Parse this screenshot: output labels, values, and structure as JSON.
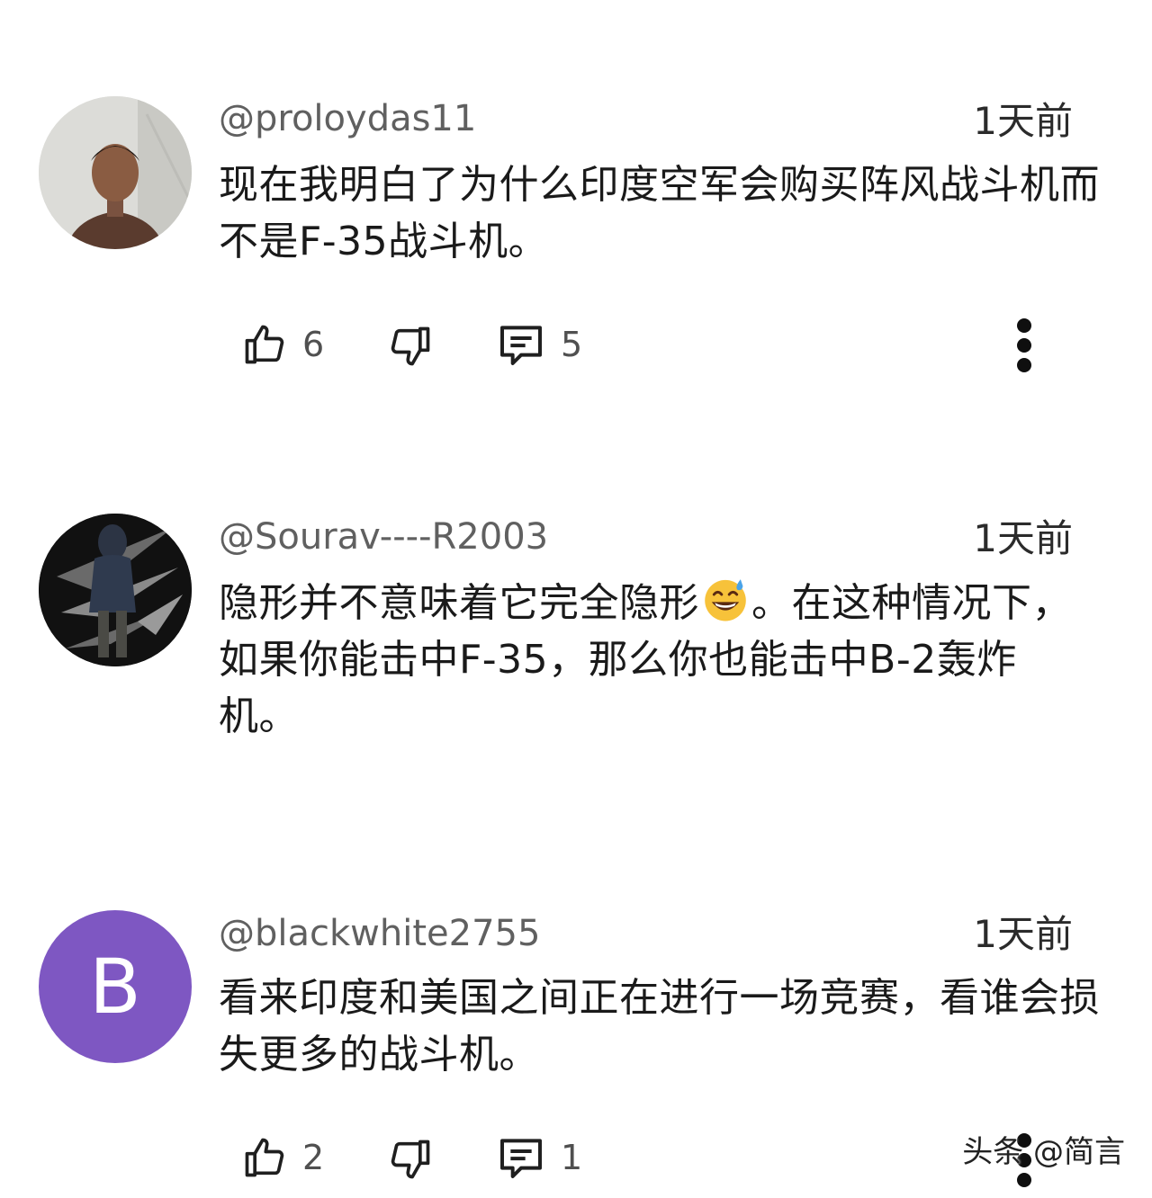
{
  "comments": [
    {
      "handle": "@proloydas11",
      "time": "1天前",
      "text": "现在我明白了为什么印度空军会购买阵风战斗机而不是F-35战斗机。",
      "likes": "6",
      "replies": "5",
      "avatar_icon": "user-photo-avatar"
    },
    {
      "handle": "@Sourav----R2003",
      "time": "1天前",
      "text_before_emoji": "隐形并不意味着它完全隐形",
      "emoji": "grinning-sweat-emoji",
      "text_after_emoji": "。在这种情况下，如果你能击中F-35，那么你也能击中B-2轰炸机。",
      "avatar_icon": "hooded-figure-avatar"
    },
    {
      "handle": "@blackwhite2755",
      "time": "1天前",
      "text": "看来印度和美国之间正在进行一场竞赛，看谁会损失更多的战斗机。",
      "likes": "2",
      "replies": "1",
      "avatar_letter": "B",
      "avatar_color": "#7e57c2"
    }
  ],
  "watermark": "头条 @简言"
}
